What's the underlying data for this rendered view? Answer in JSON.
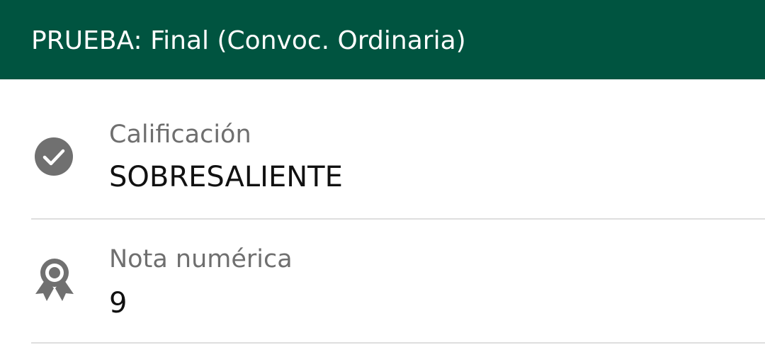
{
  "header": {
    "title": "PRUEBA: Final (Convoc. Ordinaria)",
    "background_color": "#005440"
  },
  "rows": [
    {
      "icon": "check-circle-icon",
      "label": "Calificación",
      "value": "SOBRESALIENTE"
    },
    {
      "icon": "award-ribbon-icon",
      "label": "Nota numérica",
      "value": "9"
    }
  ],
  "colors": {
    "icon": "#707070",
    "label": "#6f6f6f",
    "value": "#111111",
    "divider": "#dedede"
  }
}
